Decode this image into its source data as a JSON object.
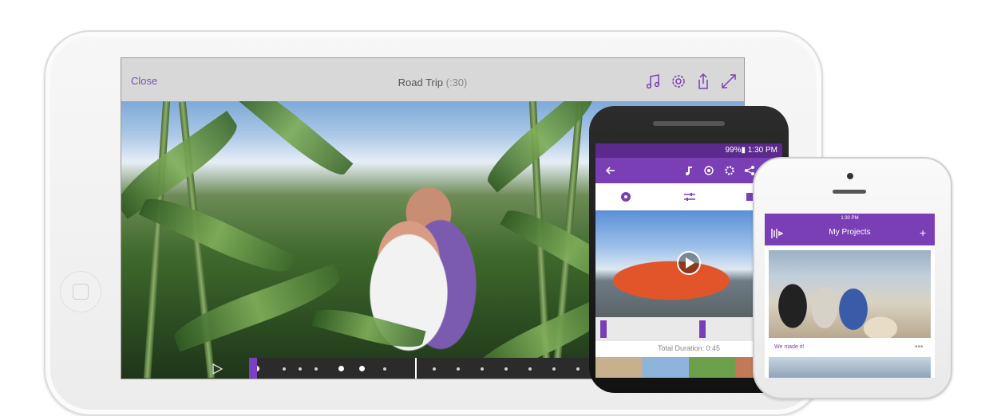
{
  "ipad_app": {
    "close_label": "Close",
    "project_title": "Road Trip",
    "project_duration": "(:30)",
    "toolbar_icons": [
      "music-icon",
      "settings-icon",
      "share-icon",
      "expand-icon"
    ],
    "playback_progress": 0.34
  },
  "android_app": {
    "status": "99%▮ 1:30 PM",
    "toolbar_icons": [
      "back-icon",
      "music-icon",
      "theme-icon",
      "settings-icon",
      "share-icon"
    ],
    "tabs": [
      "theme-icon",
      "adjust-icon",
      "layout-icon"
    ],
    "total_duration": "Total Duration: 0:45"
  },
  "iphone_app": {
    "status_time": "1:30 PM",
    "title": "My Projects",
    "caption": "We made it!",
    "more": "•••",
    "add_icon": "+"
  },
  "colors": {
    "accent": "#7b3fb5",
    "status": "#5b2a8c"
  }
}
